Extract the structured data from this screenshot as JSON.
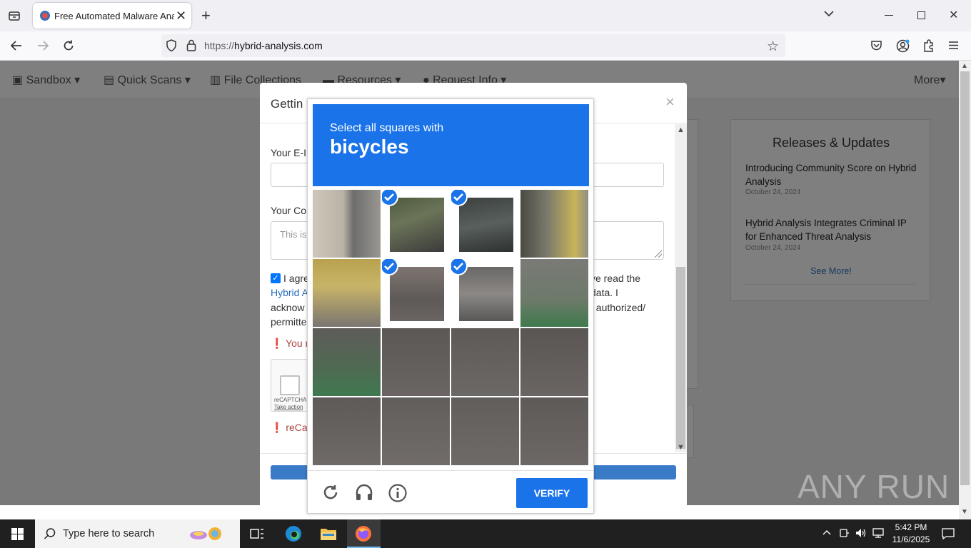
{
  "browser": {
    "tab_title": "Free Automated Malware Analy",
    "url_prefix": "https://",
    "url_host": "hybrid-analysis.com"
  },
  "site": {
    "nav": [
      "Sandbox",
      "Quick Scans",
      "File Collections",
      "Resources",
      "Request Info"
    ],
    "nav_more": "More",
    "releases": {
      "title": "Releases & Updates",
      "items": [
        {
          "title": "Introducing Community Score on Hybrid Analysis",
          "date": "October 24, 2024"
        },
        {
          "title": "Hybrid Analysis Integrates Criminal IP for Enhanced Threat Analysis",
          "date": "October 24, 2024"
        }
      ],
      "see_more": "See More!"
    }
  },
  "modal": {
    "title": "Gettin",
    "close": "×",
    "label_email": "Your E-I",
    "label_comment": "Your Co",
    "comment_placeholder": "This is",
    "agree_line1": "I agre",
    "agree_line1_right": "ve read the",
    "agree_link": "Hybrid A",
    "agree_line2_right": "data. I",
    "agree_line3": "acknow",
    "agree_line3_right": "t authorized/",
    "agree_line4": "permitte",
    "error1": "You r",
    "recaptcha_label": "reCAPTCHA",
    "recaptcha_link": "Take action",
    "error2": "reCap"
  },
  "captcha": {
    "instruction": "Select all squares with",
    "object": "bicycles",
    "selected_tiles": [
      1,
      2,
      5,
      6
    ],
    "verify_label": "VERIFY",
    "icons": [
      "reload-icon",
      "audio-icon",
      "info-icon"
    ]
  },
  "taskbar": {
    "search_placeholder": "Type here to search",
    "time": "5:42 PM",
    "date": "11/6/2025"
  },
  "watermark": "ANY RUN",
  "colors": {
    "captcha_blue": "#1a73e8",
    "link_blue": "#2a6ebb",
    "error_red": "#a94442"
  }
}
